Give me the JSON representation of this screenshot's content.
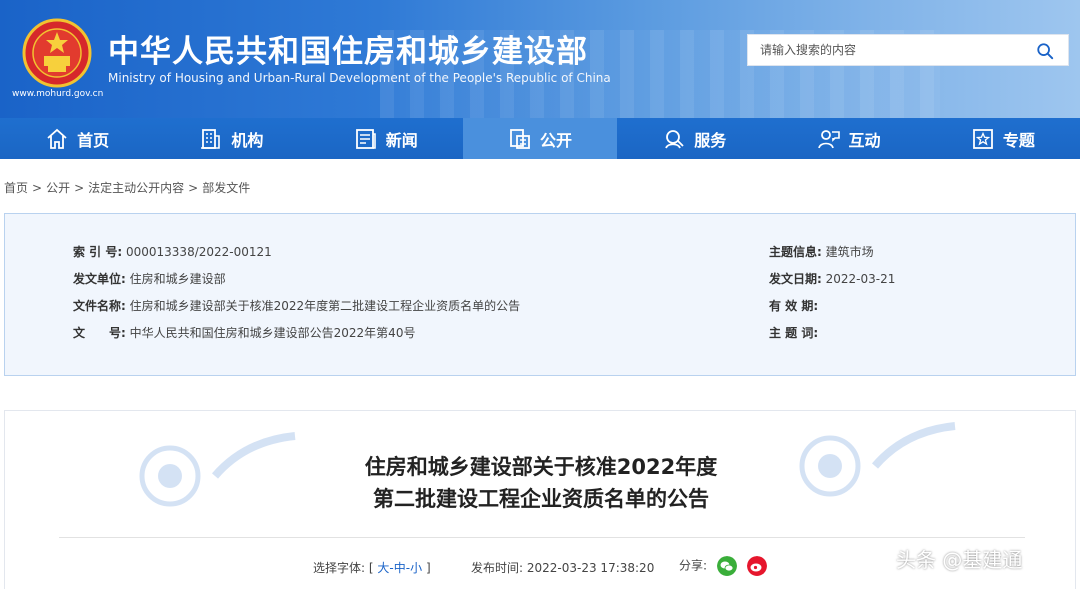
{
  "header": {
    "title_cn": "中华人民共和国住房和城乡建设部",
    "title_en": "Ministry of Housing and Urban-Rural Development of the People's Republic of China",
    "site_url": "www.mohurd.gov.cn",
    "search_placeholder": "请输入搜索的内容",
    "search_icon": "search-icon",
    "emblem": "national-emblem"
  },
  "nav": [
    {
      "label": "首页",
      "icon": "home-icon"
    },
    {
      "label": "机构",
      "icon": "building-icon"
    },
    {
      "label": "新闻",
      "icon": "news-icon"
    },
    {
      "label": "公开",
      "icon": "open-doc-icon",
      "active": true
    },
    {
      "label": "服务",
      "icon": "service-icon"
    },
    {
      "label": "互动",
      "icon": "interact-icon"
    },
    {
      "label": "专题",
      "icon": "star-icon"
    }
  ],
  "breadcrumb": [
    "首页",
    "公开",
    "法定主动公开内容",
    "部发文件"
  ],
  "breadcrumb_sep": ">",
  "info": {
    "index_k": "索 引 号:",
    "index_v": "000013338/2022-00121",
    "issuer_k": "发文单位:",
    "issuer_v": "住房和城乡建设部",
    "docname_k": "文件名称:",
    "docname_v": "住房和城乡建设部关于核准2022年度第二批建设工程企业资质名单的公告",
    "docno_k": "文　　号:",
    "docno_v": "中华人民共和国住房和城乡建设部公告2022年第40号",
    "topic_k": "主题信息:",
    "topic_v": "建筑市场",
    "date_k": "发文日期:",
    "date_v": "2022-03-21",
    "valid_k": "有 效 期:",
    "valid_v": "",
    "keywords_k": "主 题 词:",
    "keywords_v": ""
  },
  "article": {
    "title_line1": "住房和城乡建设部关于核准2022年度",
    "title_line2": "第二批建设工程企业资质名单的公告",
    "font_label": "选择字体:",
    "font_open": "[",
    "font_large": "大",
    "font_mid": "中",
    "font_small": "小",
    "font_close": "]",
    "font_dash": "-",
    "publish_label": "发布时间:",
    "publish_time": "2022-03-23 17:38:20",
    "share_label": "分享:"
  },
  "overlay": {
    "source_tag": "头条 @基建通"
  },
  "colors": {
    "brand_blue": "#1a63c8",
    "nav_active": "#4a90dd",
    "info_bg": "#f1f6fd"
  }
}
